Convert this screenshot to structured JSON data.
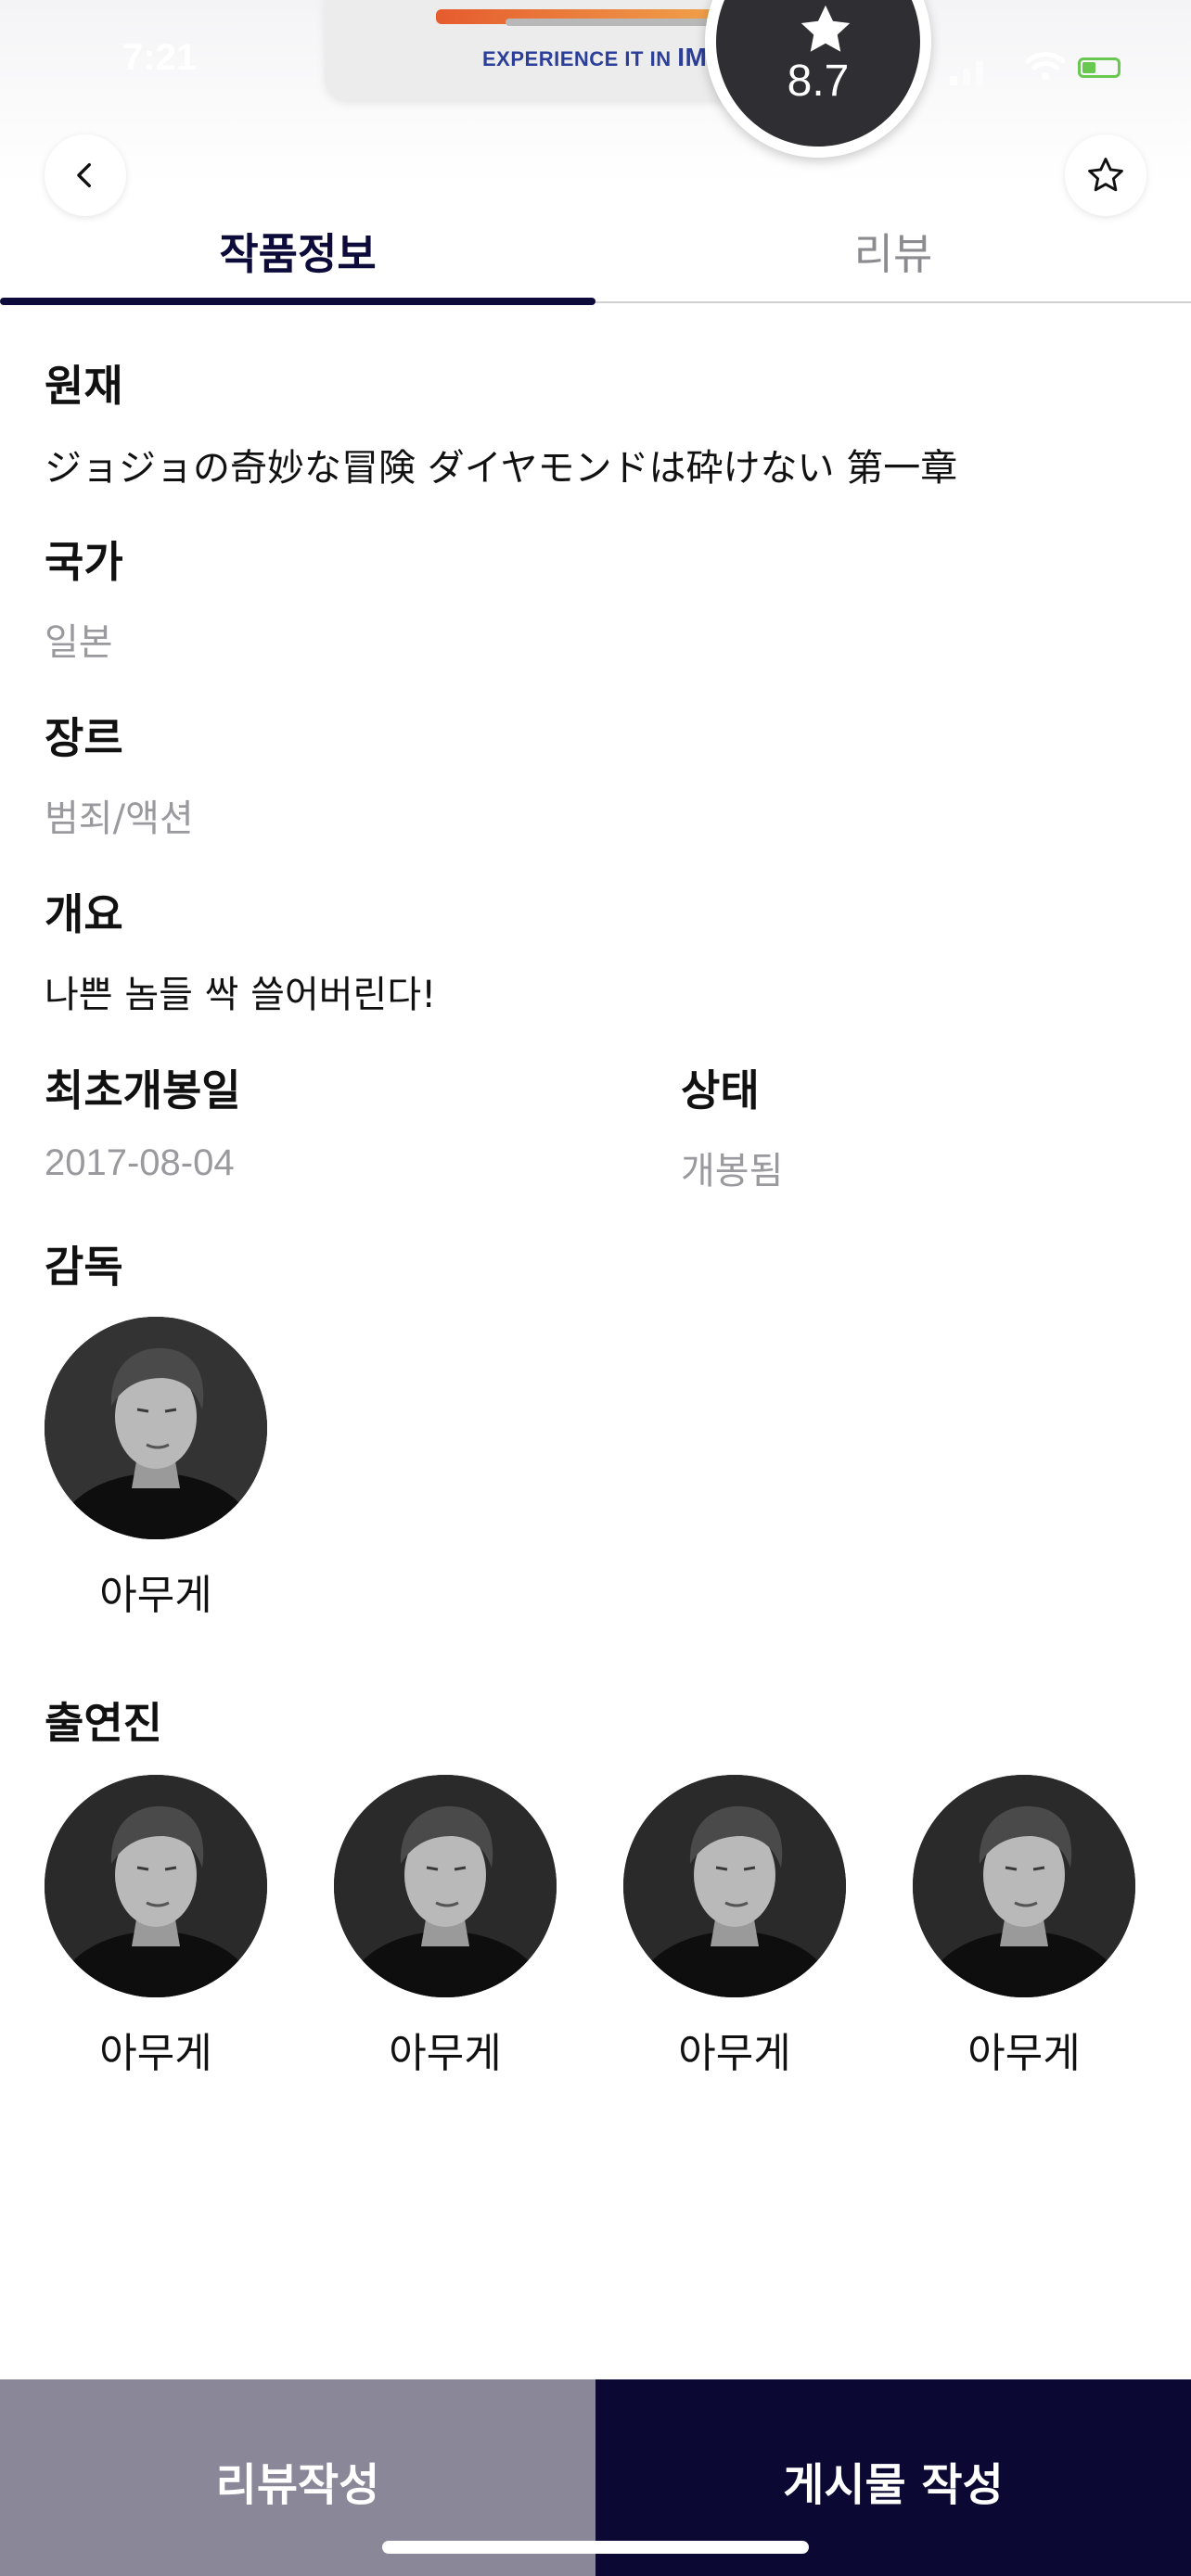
{
  "status": {
    "time": "7:21"
  },
  "poster": {
    "experience": "EXPERIENCE IT IN",
    "imax": "IMAX"
  },
  "rating": {
    "value": "8.7"
  },
  "tabs": [
    {
      "label": "작품정보",
      "active": true
    },
    {
      "label": "리뷰",
      "active": false
    }
  ],
  "details": {
    "original_label": "원재",
    "original_value": "ジョジョの奇妙な冒険 ダイヤモンドは砕けない 第一章",
    "country_label": "국가",
    "country_value": "일본",
    "genre_label": "장르",
    "genre_value": "범죄/액션",
    "synopsis_label": "개요",
    "synopsis_value": "나쁜 놈들 싹 쓸어버린다!",
    "release_label": "최초개봉일",
    "release_value": "2017-08-04",
    "status_label": "상태",
    "status_value": "개봉됨"
  },
  "director": {
    "label": "감독",
    "people": [
      {
        "name": "아무게"
      }
    ]
  },
  "cast": {
    "label": "출연진",
    "people": [
      {
        "name": "아무게"
      },
      {
        "name": "아무게"
      },
      {
        "name": "아무게"
      },
      {
        "name": "아무게"
      }
    ]
  },
  "actions": {
    "review_label": "리뷰작성",
    "post_label": "게시물 작성"
  },
  "colors": {
    "primary": "#0b0933",
    "secondary_button": "#8a8799",
    "muted_text": "#9a9a9e"
  }
}
